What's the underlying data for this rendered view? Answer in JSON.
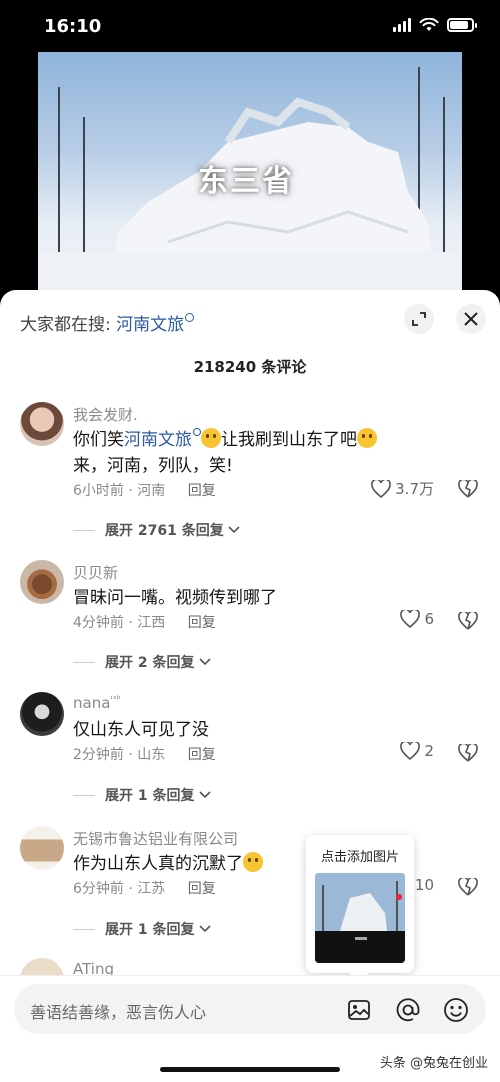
{
  "status_bar": {
    "time": "16:10",
    "battery_level": 0.85
  },
  "video": {
    "overlay_title": "东三省"
  },
  "sheet": {
    "search_prefix": "大家都在搜:",
    "search_keyword": "河南文旅",
    "comment_count_title": "218240 条评论"
  },
  "comments": [
    {
      "name": "我会发财.",
      "text_before": "你们笑",
      "keyword": "河南文旅",
      "text_after": "让我刷到山东了吧",
      "text_line2": "来，河南，列队，笑!",
      "time": "6小时前",
      "location": "河南",
      "reply_label": "回复",
      "likes": "3.7万",
      "expand_label": "展开 2761 条回复"
    },
    {
      "name": "贝贝新",
      "text": "冒昧问一嘴。视频传到哪了",
      "time": "4分钟前",
      "location": "江西",
      "reply_label": "回复",
      "likes": "6",
      "expand_label": "展开 2 条回复"
    },
    {
      "name": "nana",
      "name_suffix": "ᶦˣᵇ",
      "text": "仅山东人可见了没",
      "time": "2分钟前",
      "location": "山东",
      "reply_label": "回复",
      "likes": "2",
      "expand_label": "展开 1 条回复"
    },
    {
      "name": "无锡市鲁达铝业有限公司",
      "text": "作为山东人真的沉默了",
      "time": "6分钟前",
      "location": "江苏",
      "reply_label": "回复",
      "likes": "10",
      "expand_label": "展开 1 条回复"
    },
    {
      "name": "ATing"
    }
  ],
  "popup": {
    "label": "点击添加图片"
  },
  "input_bar": {
    "placeholder": "善语结善缘，恶言伤人心"
  },
  "watermark": "头条 @兔兔在创业",
  "colors": {
    "keyword": "#2d5aa6",
    "meta": "#8a8a8a"
  }
}
